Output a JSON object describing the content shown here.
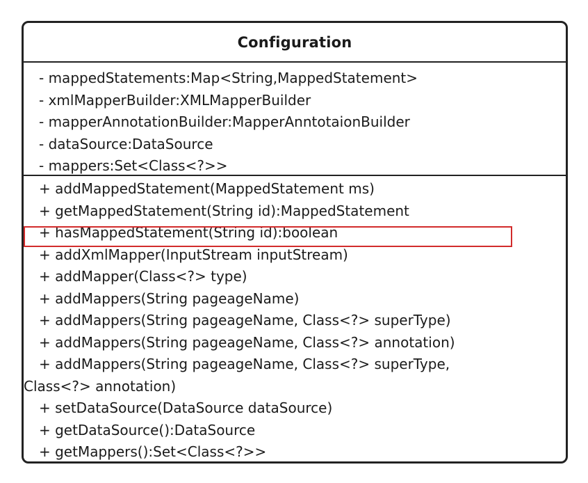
{
  "diagram": {
    "class_name": "Configuration",
    "attributes": [
      "- mappedStatements:Map<String,MappedStatement>",
      "- xmlMapperBuilder:XMLMapperBuilder",
      "- mapperAnnotationBuilder:MapperAnntotaionBuilder",
      "- dataSource:DataSource",
      "- mappers:Set<Class<?>>"
    ],
    "methods": [
      "+ addMappedStatement(MappedStatement ms)",
      "+ getMappedStatement(String id):MappedStatement",
      "+ hasMappedStatement(String id):boolean",
      "+ addXmlMapper(InputStream inputStream)",
      "+ addMapper(Class<?> type)",
      "+ addMappers(String pageageName)",
      "+ addMappers(String pageageName, Class<?> superType)",
      "+ addMappers(String pageageName, Class<?> annotation)",
      "+ addMappers(String pageageName, Class<?> superType,",
      "Class<?> annotation)",
      "+ setDataSource(DataSource dataSource)",
      "+ getDataSource():DataSource",
      "+ getMappers():Set<Class<?>>"
    ],
    "highlighted_method_index": 1,
    "colors": {
      "border": "#222222",
      "highlight": "#d22b2b",
      "text": "#1a1a1a",
      "background": "#ffffff"
    }
  }
}
